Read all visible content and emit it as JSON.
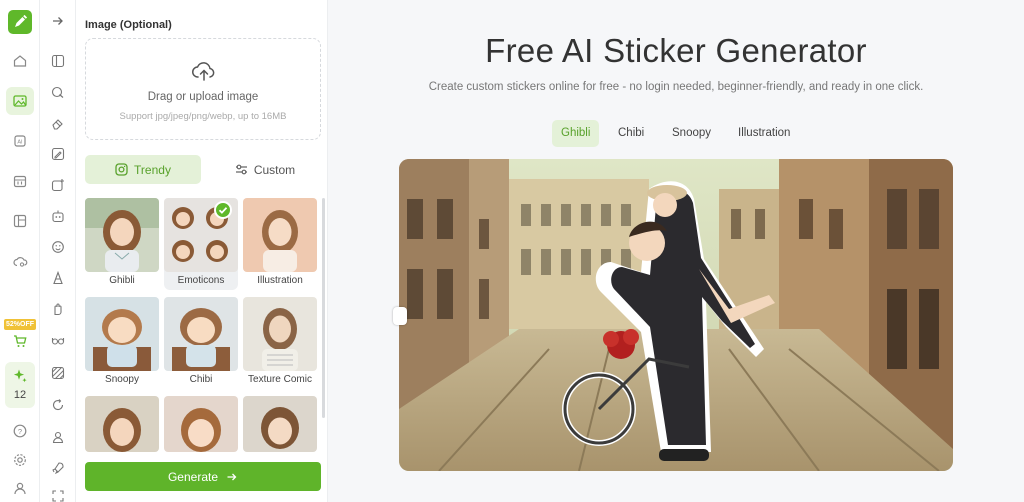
{
  "brand": {
    "accent": "#5fb82a",
    "accent_light": "#e4f1d8"
  },
  "rail": {
    "icons": [
      "pencil-logo-icon",
      "home-icon",
      "image-icon",
      "ai-icon",
      "calendar-icon",
      "layout-icon",
      "cloud-sync-icon",
      "cart-icon",
      "sparkle-icon",
      "help-icon",
      "settings-icon",
      "user-icon"
    ],
    "promo_badge": "52%OFF",
    "credits": "12"
  },
  "toolbar": {
    "icons": [
      "collapse-arrow-icon",
      "panel-icon",
      "brush-icon",
      "eraser-icon",
      "image-edit-icon",
      "image-add-icon",
      "robot-icon",
      "face-icon",
      "figure-icon",
      "hand-icon",
      "glasses-icon",
      "texture-icon",
      "cycle-icon",
      "person-icon",
      "rocket-icon",
      "expand-icon"
    ]
  },
  "panel": {
    "image_label": "Image (Optional)",
    "upload_text": "Drag or upload image",
    "upload_hint": "Support jpg/jpeg/png/webp, up to 16MB",
    "tab_trendy": "Trendy",
    "tab_custom": "Custom",
    "styles": [
      {
        "label": "Ghibli",
        "selected": false
      },
      {
        "label": "Emoticons",
        "selected": true
      },
      {
        "label": "Illustration",
        "selected": false
      },
      {
        "label": "Snoopy",
        "selected": false
      },
      {
        "label": "Chibi",
        "selected": false
      },
      {
        "label": "Texture Comic",
        "selected": false
      },
      {
        "label": "",
        "selected": false
      },
      {
        "label": "",
        "selected": false
      },
      {
        "label": "",
        "selected": false
      }
    ],
    "generate_label": "Generate"
  },
  "main": {
    "title": "Free AI Sticker Generator",
    "subtitle": "Create custom stickers online for free - no login needed, beginner-friendly, and ready in one click.",
    "tabs": [
      {
        "label": "Ghibli",
        "active": true
      },
      {
        "label": "Chibi",
        "active": false
      },
      {
        "label": "Snoopy",
        "active": false
      },
      {
        "label": "Illustration",
        "active": false
      }
    ]
  }
}
